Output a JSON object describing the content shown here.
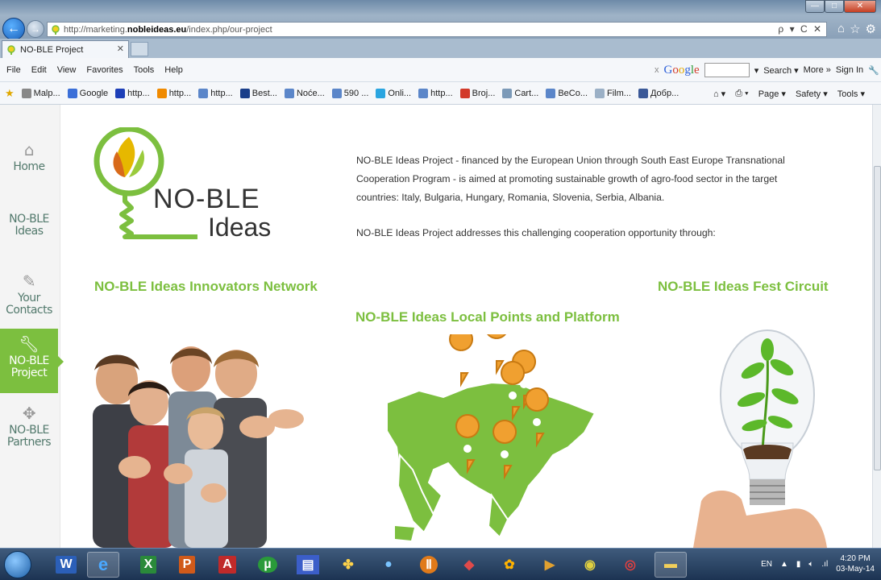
{
  "browser": {
    "url_prefix": "http://marketing.",
    "url_domain": "nobleideas.eu",
    "url_path": "/index.php/our-project",
    "addr_tools": "ρ ▾ C ✕",
    "tab_title": "NO-BLE Project",
    "tab_close": "✕",
    "nav_back": "←",
    "nav_forward": "→",
    "win_min": "—",
    "win_max": "□",
    "win_close": "✕",
    "menu": [
      "File",
      "Edit",
      "View",
      "Favorites",
      "Tools",
      "Help"
    ],
    "google": {
      "close": "x",
      "search_label": "Search ▾",
      "more_label": "More »",
      "signin_label": "Sign In"
    },
    "favorites": [
      "Malp...",
      "Google",
      "http...",
      "http...",
      "http...",
      "Best...",
      "Noće...",
      "590 ...",
      "Onli...",
      "http...",
      "Broj...",
      "Cart...",
      "BeCo...",
      "Film...",
      "Добр..."
    ],
    "command_bar": [
      "Page ▾",
      "Safety ▾",
      "Tools ▾"
    ]
  },
  "sidebar": {
    "items": [
      {
        "label": "Home"
      },
      {
        "label": "NO-BLE Ideas"
      },
      {
        "label": "Your Contacts"
      },
      {
        "label": "NO-BLE Project"
      },
      {
        "label": "NO-BLE Partners"
      }
    ],
    "active_color": "#7cbf3f"
  },
  "logo": {
    "title": "NO-BLE",
    "subtitle": "Ideas"
  },
  "content": {
    "intro": "NO-BLE Ideas Project - financed by the European Union through South East Europe Transnational Cooperation Program - is aimed at promoting sustainable growth of agro-food sector in the target countries: Italy, Bulgaria, Hungary, Romania, Slovenia, Serbia, Albania.",
    "intro2": "NO-BLE Ideas Project addresses this challenging cooperation opportunity through:",
    "heading_network": "NO-BLE Ideas Innovators Network",
    "heading_local": "NO-BLE Ideas Local Points and Platform",
    "heading_fest": "NO-BLE Ideas Fest Circuit",
    "accent": "#7cbf3f"
  },
  "taskbar": {
    "language": "EN",
    "time": "4:20 PM",
    "date": "03-May-14"
  }
}
